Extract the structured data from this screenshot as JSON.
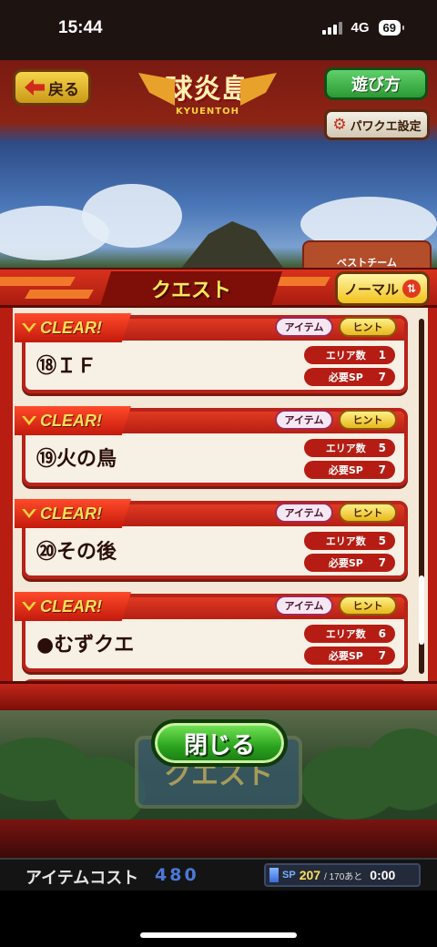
{
  "status": {
    "time": "15:44",
    "network": "4G",
    "battery": "69"
  },
  "top": {
    "back_label": "戻る",
    "logo_main": "球炎島",
    "logo_sub": "KYUENTOH",
    "help_label": "遊び方",
    "settings_label": "パワクエ設定",
    "best_team_label": "ベストチーム"
  },
  "quest_panel": {
    "title": "クエスト",
    "mode_label": "ノーマル",
    "items": [
      {
        "badge": "CLEAR!",
        "item_label": "アイテム",
        "hint_label": "ヒント",
        "name": "⑱ＩＦ",
        "area_label": "エリア数",
        "area_value": "1",
        "sp_label": "必要SP",
        "sp_value": "7"
      },
      {
        "badge": "CLEAR!",
        "item_label": "アイテム",
        "hint_label": "ヒント",
        "name": "⑲火の鳥",
        "area_label": "エリア数",
        "area_value": "5",
        "sp_label": "必要SP",
        "sp_value": "7"
      },
      {
        "badge": "CLEAR!",
        "item_label": "アイテム",
        "hint_label": "ヒント",
        "name": "⑳その後",
        "area_label": "エリア数",
        "area_value": "5",
        "sp_label": "必要SP",
        "sp_value": "7"
      },
      {
        "badge": "CLEAR!",
        "item_label": "アイテム",
        "hint_label": "ヒント",
        "name": "●むずクエ",
        "area_label": "エリア数",
        "area_value": "6",
        "sp_label": "必要SP",
        "sp_value": "7"
      }
    ]
  },
  "close_label": "閉じる",
  "sign_label": "クエスト",
  "bottom": {
    "cost_label": "アイテムコスト",
    "cost_value": "480",
    "sp_label": "SP",
    "sp_value": "207",
    "sp_sub": "/ 170あと",
    "sp_time": "0:00"
  },
  "colors": {
    "accent_red": "#b51d14",
    "clear_yellow": "#ffe05a",
    "close_green": "#2aa21e"
  }
}
